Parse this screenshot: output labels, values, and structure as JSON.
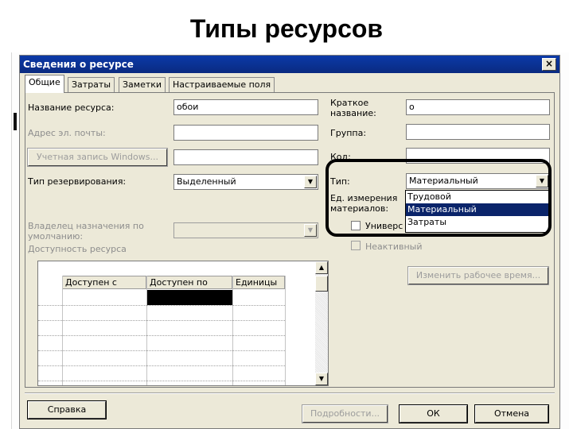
{
  "slide": {
    "title": "Типы ресурсов"
  },
  "dialog": {
    "title": "Сведения о ресурсе",
    "close_glyph": "×",
    "tabs": [
      {
        "label": "Общие",
        "active": true
      },
      {
        "label": "Затраты",
        "active": false
      },
      {
        "label": "Заметки",
        "active": false
      },
      {
        "label": "Настраиваемые поля",
        "active": false
      }
    ],
    "general": {
      "resource_name_label": "Название ресурса:",
      "resource_name_value": "обои",
      "email_label": "Адрес эл. почты:",
      "email_value": "",
      "windows_account_button": "Учетная запись Windows...",
      "windows_account_value": "",
      "booking_type_label": "Тип резервирования:",
      "booking_type_value": "Выделенный",
      "short_name_label_line1": "Краткое",
      "short_name_label_line2": "название:",
      "short_name_value": "о",
      "group_label": "Группа:",
      "group_value": "",
      "code_label": "Код:",
      "code_value": "",
      "type_label": "Тип:",
      "type_value": "Материальный",
      "type_options": [
        "Трудовой",
        "Материальный",
        "Затраты"
      ],
      "type_selected_index": 1,
      "material_units_label_line1": "Ед. измерения",
      "material_units_label_line2": "материалов:",
      "generic_checkbox_label": "Универс",
      "inactive_checkbox_label": "Неактивный",
      "default_owner_label_line1": "Владелец назначения по",
      "default_owner_label_line2": "умолчанию:",
      "availability_label": "Доступность ресурса",
      "change_working_time_button": "Изменить рабочее время...",
      "availability_columns": [
        "Доступен с",
        "Доступен по",
        "Единицы"
      ]
    },
    "footer": {
      "help_button": "Справка",
      "details_button": "Подробности...",
      "ok_button": "ОК",
      "cancel_button": "Отмена"
    },
    "colors": {
      "titlebar": "#0a2a80",
      "selection": "#0a246a",
      "face": "#ece9d8"
    }
  }
}
